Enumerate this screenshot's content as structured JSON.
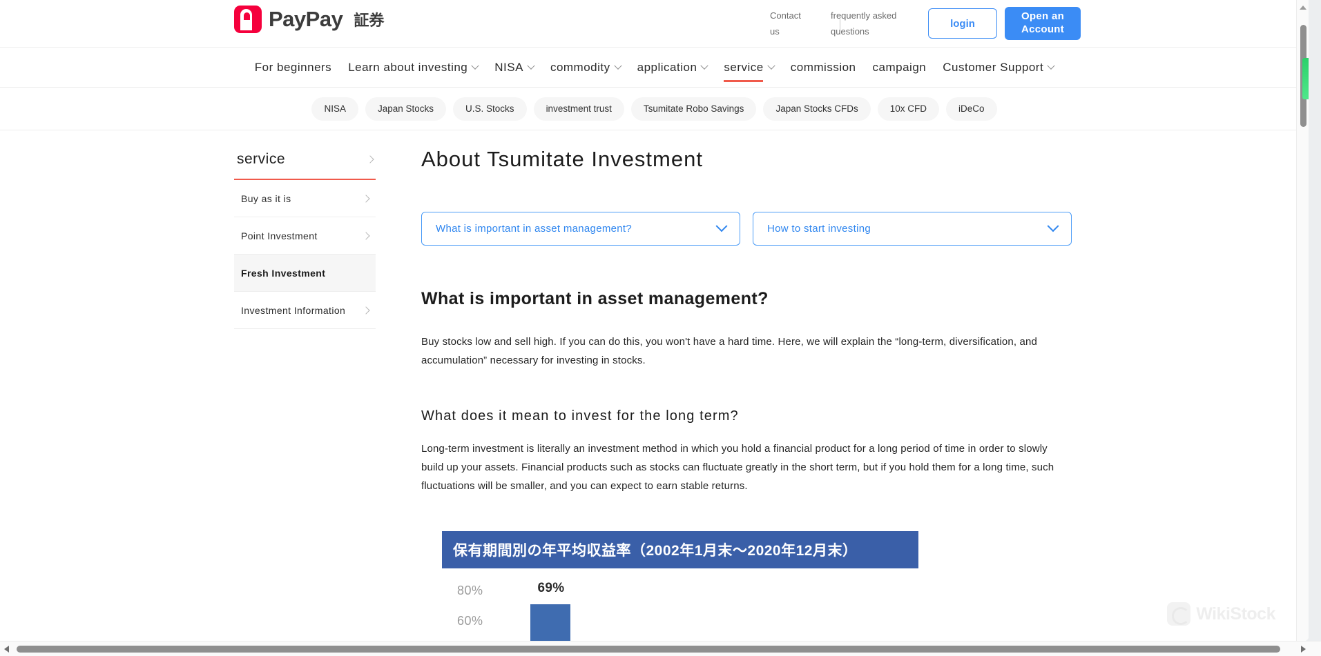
{
  "header": {
    "logo_text": "PayPay",
    "logo_suffix": "証券",
    "links": [
      {
        "label": "Contact us"
      },
      {
        "label": "frequently asked questions"
      }
    ],
    "login_label": "login",
    "open_account_label": "Open an Account"
  },
  "main_nav": {
    "items": [
      {
        "label": "For beginners",
        "has_caret": false,
        "active": false
      },
      {
        "label": "Learn about investing",
        "has_caret": true,
        "active": false
      },
      {
        "label": "NISA",
        "has_caret": true,
        "active": false
      },
      {
        "label": "commodity",
        "has_caret": true,
        "active": false
      },
      {
        "label": "application",
        "has_caret": true,
        "active": false
      },
      {
        "label": "service",
        "has_caret": true,
        "active": true
      },
      {
        "label": "commission",
        "has_caret": false,
        "active": false
      },
      {
        "label": "campaign",
        "has_caret": false,
        "active": false
      },
      {
        "label": "Customer Support",
        "has_caret": true,
        "active": false
      }
    ]
  },
  "pill_nav": {
    "items": [
      {
        "label": "NISA"
      },
      {
        "label": "Japan Stocks"
      },
      {
        "label": "U.S. Stocks"
      },
      {
        "label": "investment trust"
      },
      {
        "label": "Tsumitate Robo Savings"
      },
      {
        "label": "Japan Stocks CFDs"
      },
      {
        "label": "10x CFD"
      },
      {
        "label": "iDeCo"
      }
    ]
  },
  "sidebar": {
    "heading": "service",
    "items": [
      {
        "label": "Buy as it is",
        "active": false
      },
      {
        "label": "Point Investment",
        "active": false
      },
      {
        "label": "Fresh Investment",
        "active": true
      },
      {
        "label": "Investment Information",
        "active": false
      }
    ]
  },
  "main": {
    "page_title": "About Tsumitate Investment",
    "accordions": [
      {
        "label": "What is important in asset management?"
      },
      {
        "label": "How to start investing"
      }
    ],
    "section_heading": "What is important in asset management?",
    "section_paragraph": "Buy stocks low and sell high. If you can do this, you won't have a hard time. Here, we will explain the “long-term, diversification, and accumulation” necessary for investing in stocks.",
    "subsection_heading": "What does it mean to invest for the long term?",
    "subsection_paragraph": "Long-term investment is literally an investment method in which you hold a financial product for a long period of time in order to slowly build up your assets. Financial products such as stocks can fluctuate greatly in the short term, but if you hold them for a long time, such fluctuations will be smaller, and you can expect to earn stable returns."
  },
  "chart_data": {
    "type": "bar",
    "title": "保有期間別の年平均収益率（2002年1月末〜2020年12月末）",
    "categories": [
      ""
    ],
    "values": [
      69
    ],
    "value_labels": [
      "69%"
    ],
    "ytick_labels": [
      "80%",
      "60%"
    ],
    "ylim": [
      0,
      80
    ],
    "xlabel": "",
    "ylabel": "",
    "grid": false,
    "legend": "none",
    "series_color": "#3f6cb0",
    "banner_color": "#3a5fa8"
  },
  "watermark": {
    "text": "WikiStock"
  }
}
